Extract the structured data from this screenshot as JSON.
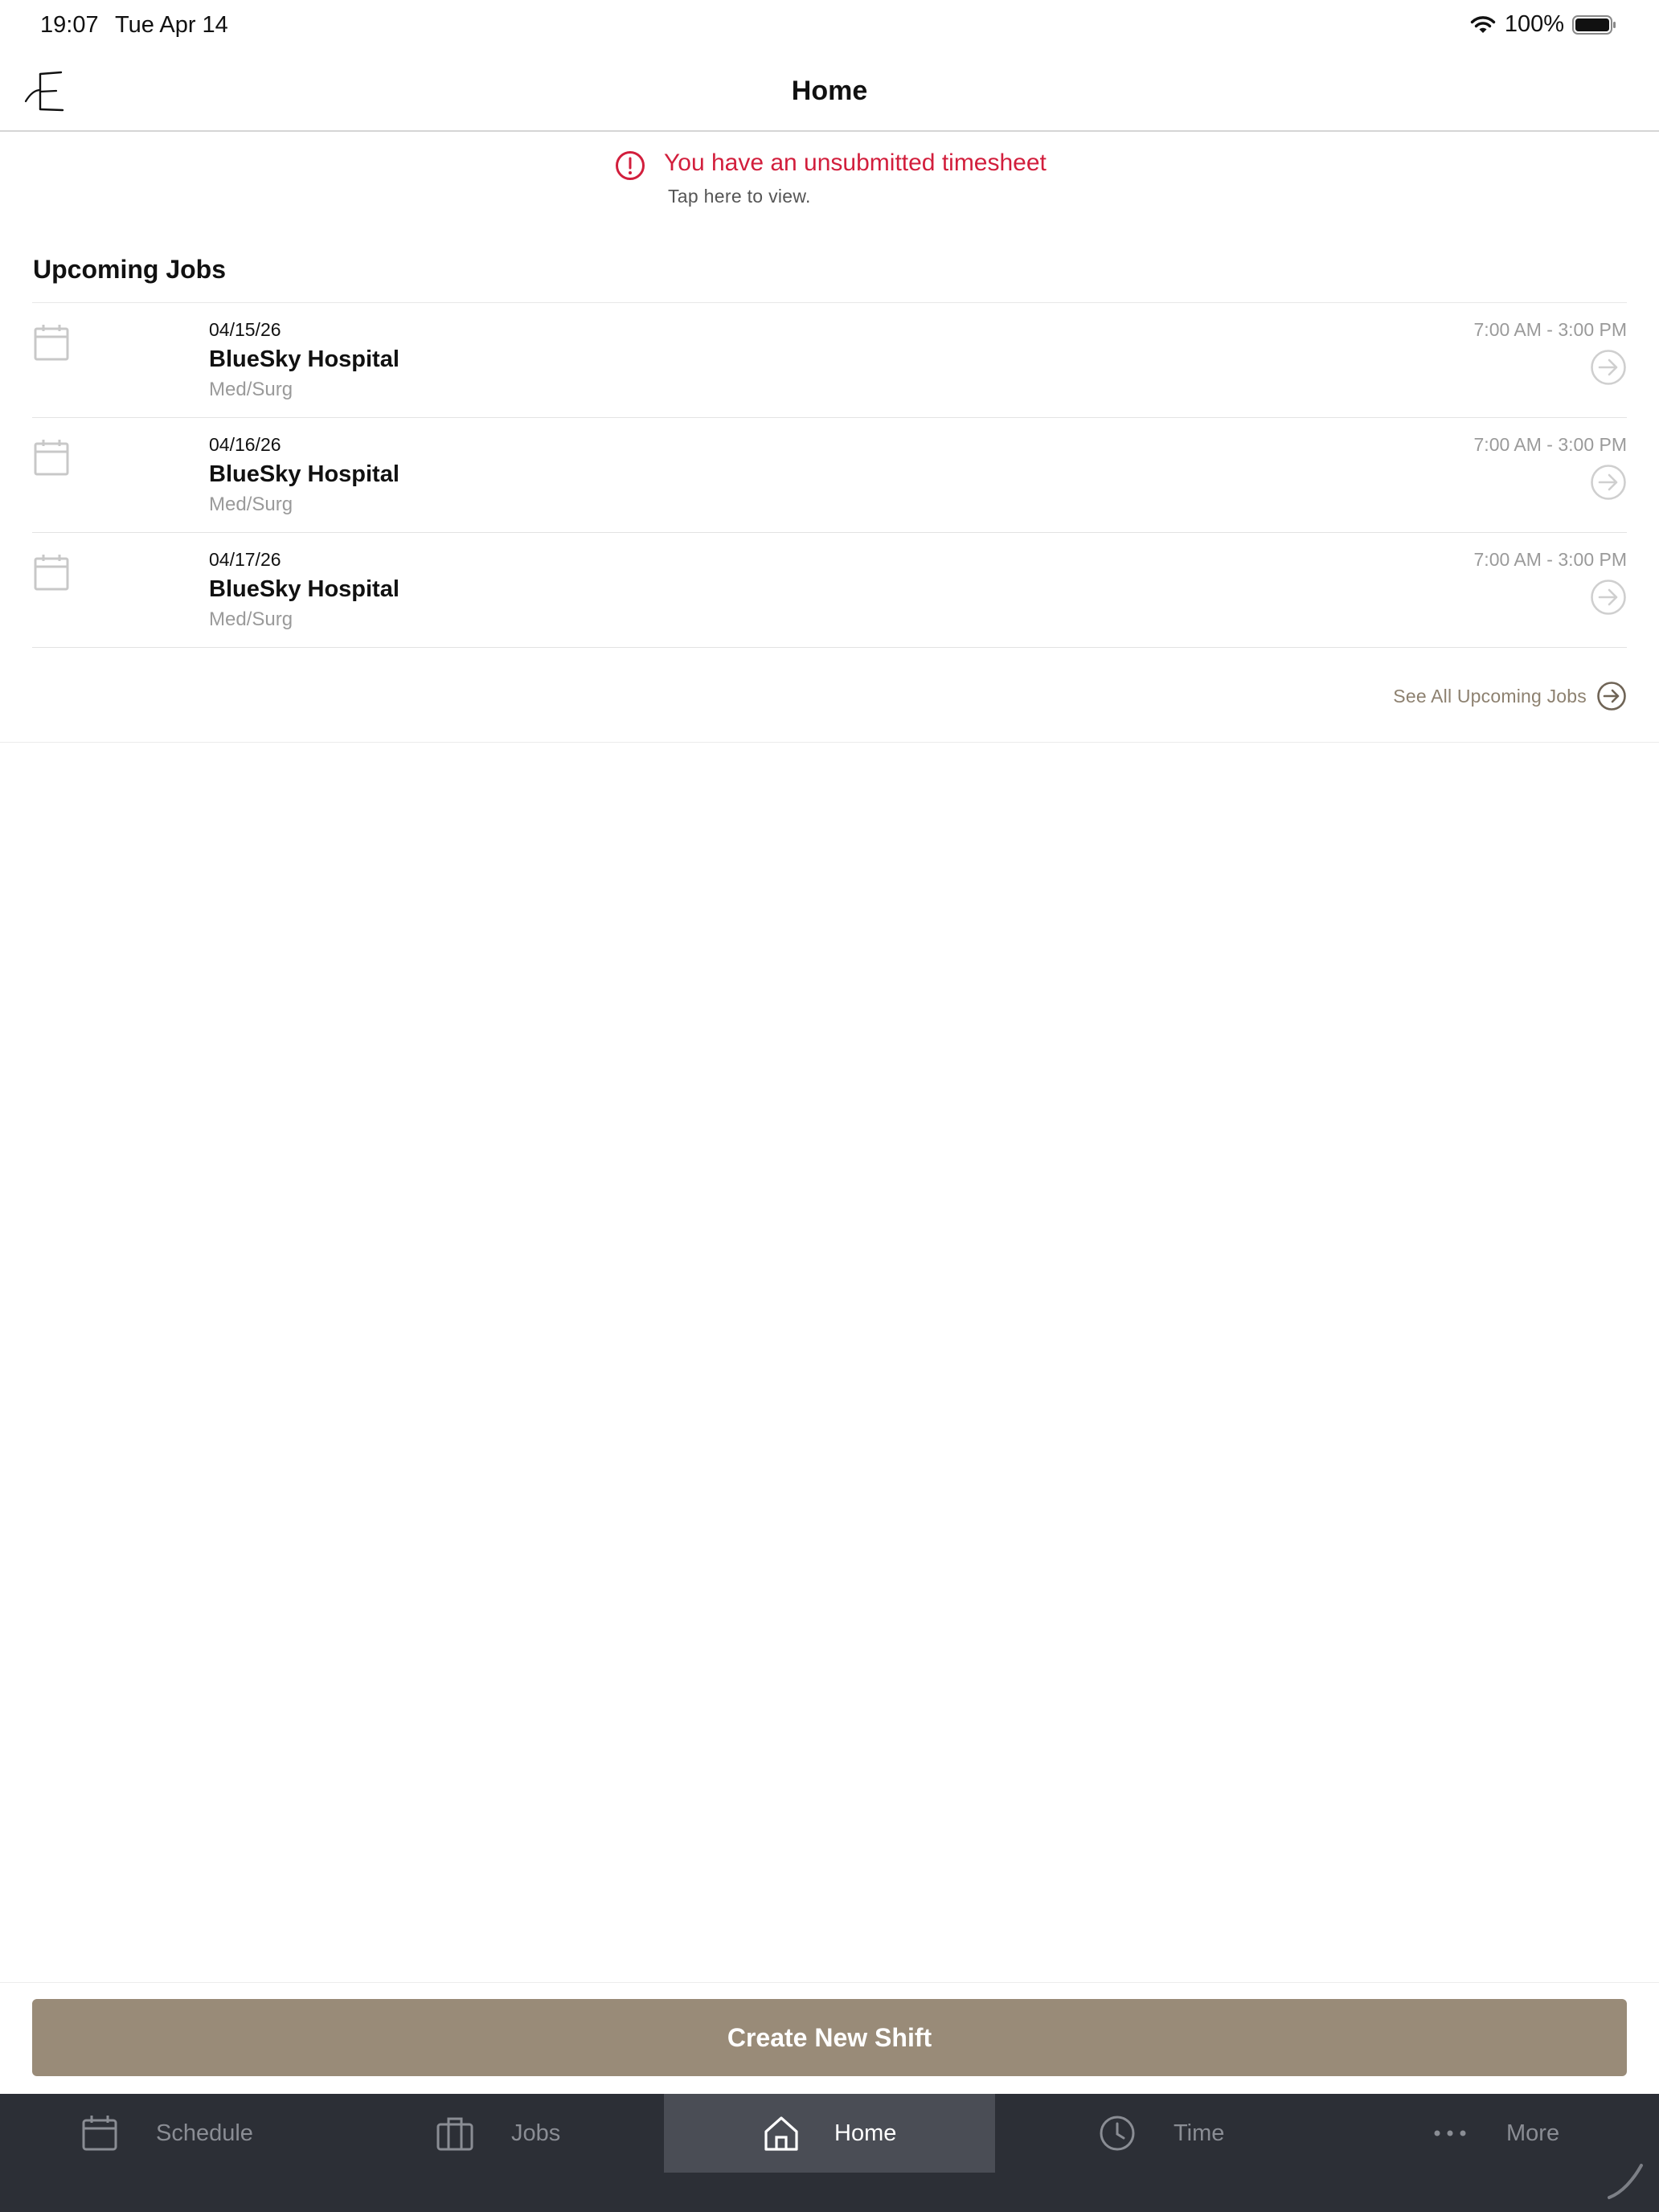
{
  "status_bar": {
    "time": "19:07",
    "date": "Tue Apr 14",
    "battery": "100%"
  },
  "header": {
    "title": "Home",
    "logo_icon": "script-e-logo"
  },
  "alert": {
    "title": "You have an unsubmitted timesheet",
    "subtitle": "Tap here to view.",
    "color": "#d21e3c"
  },
  "upcoming": {
    "title": "Upcoming Jobs",
    "jobs": [
      {
        "date": "04/15/26",
        "facility": "BlueSky Hospital",
        "department": "Med/Surg",
        "time": "7:00 AM - 3:00 PM"
      },
      {
        "date": "04/16/26",
        "facility": "BlueSky Hospital",
        "department": "Med/Surg",
        "time": "7:00 AM - 3:00 PM"
      },
      {
        "date": "04/17/26",
        "facility": "BlueSky Hospital",
        "department": "Med/Surg",
        "time": "7:00 AM - 3:00 PM"
      }
    ],
    "see_all_label": "See All Upcoming Jobs"
  },
  "create_button": {
    "label": "Create New Shift",
    "color": "#998b78"
  },
  "tabs": [
    {
      "label": "Schedule",
      "icon": "calendar-icon",
      "active": false
    },
    {
      "label": "Jobs",
      "icon": "briefcase-icon",
      "active": false
    },
    {
      "label": "Home",
      "icon": "home-icon",
      "active": true
    },
    {
      "label": "Time",
      "icon": "clock-icon",
      "active": false
    },
    {
      "label": "More",
      "icon": "more-dots-icon",
      "active": false
    }
  ],
  "colors": {
    "tab_bar": "#2c2f36",
    "tab_active": "#4a4d55",
    "accent": "#8d8170"
  }
}
